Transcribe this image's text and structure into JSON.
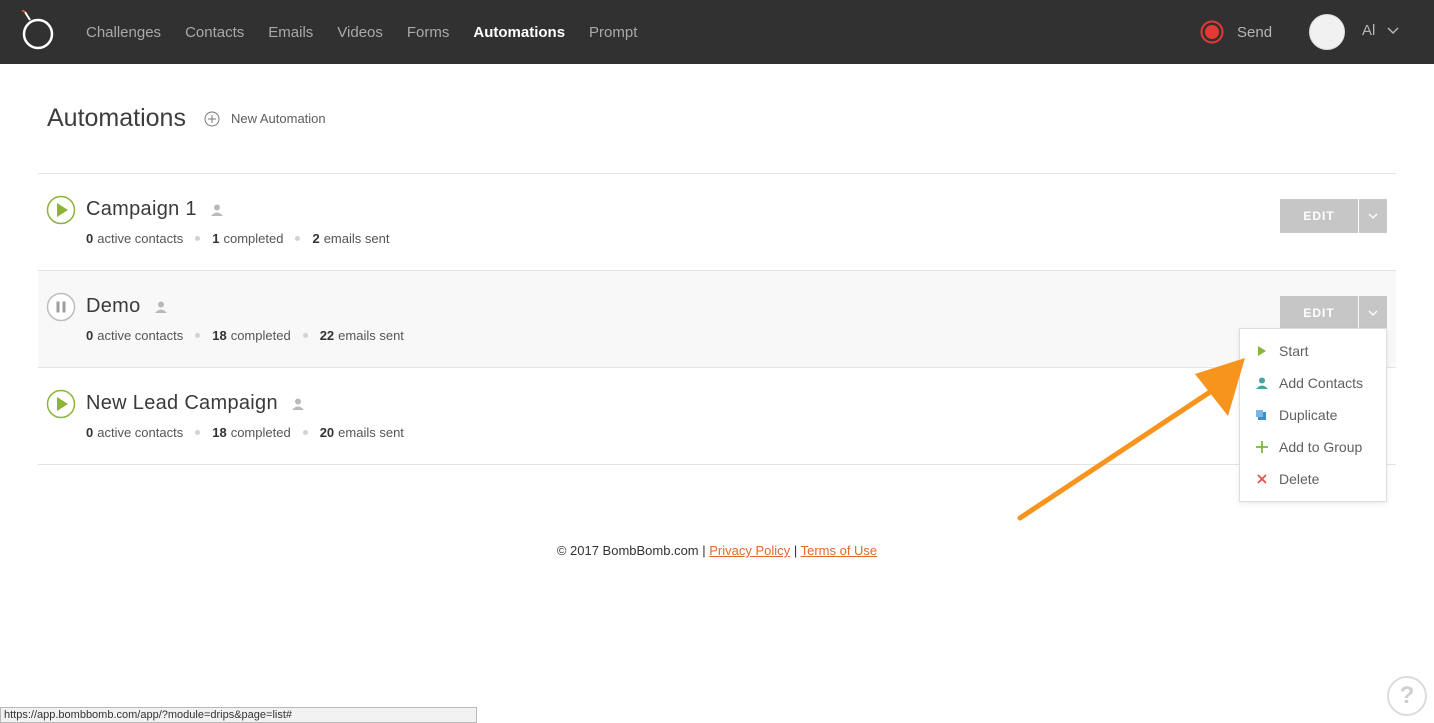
{
  "nav": {
    "items": [
      {
        "label": "Challenges",
        "active": false
      },
      {
        "label": "Contacts",
        "active": false
      },
      {
        "label": "Emails",
        "active": false
      },
      {
        "label": "Videos",
        "active": false
      },
      {
        "label": "Forms",
        "active": false
      },
      {
        "label": "Automations",
        "active": true
      },
      {
        "label": "Prompt",
        "active": false
      }
    ],
    "send_label": "Send",
    "user_name": "Al"
  },
  "page": {
    "title": "Automations",
    "new_label": "New Automation"
  },
  "automations": [
    {
      "name": "Campaign 1",
      "status": "paused-play",
      "active": "0",
      "active_label": "active contacts",
      "completed": "1",
      "completed_label": "completed",
      "emails": "2",
      "emails_label": "emails sent",
      "edit_label": "EDIT"
    },
    {
      "name": "Demo",
      "status": "paused",
      "active": "0",
      "active_label": "active contacts",
      "completed": "18",
      "completed_label": "completed",
      "emails": "22",
      "emails_label": "emails sent",
      "edit_label": "EDIT"
    },
    {
      "name": "New Lead Campaign",
      "status": "paused-play",
      "active": "0",
      "active_label": "active contacts",
      "completed": "18",
      "completed_label": "completed",
      "emails": "20",
      "emails_label": "emails sent",
      "edit_label": ""
    }
  ],
  "menu": {
    "items": [
      {
        "label": "Start",
        "icon": "play-icon",
        "color": "#8cb33a"
      },
      {
        "label": "Add Contacts",
        "icon": "person-icon",
        "color": "#4aa3a3"
      },
      {
        "label": "Duplicate",
        "icon": "duplicate-icon",
        "color": "#3d8fc6"
      },
      {
        "label": "Add to Group",
        "icon": "plus-icon",
        "color": "#7ab648"
      },
      {
        "label": "Delete",
        "icon": "x-icon",
        "color": "#d9534f"
      }
    ]
  },
  "footer": {
    "copyright": "© 2017 BombBomb.com |",
    "privacy": "Privacy Policy",
    "sep": "|",
    "terms": "Terms of Use"
  },
  "statusbar": {
    "url": "https://app.bombbomb.com/app/?module=drips&page=list#"
  },
  "help": {
    "label": "?"
  },
  "colors": {
    "topbar": "#313131",
    "accent_green": "#8cb33a",
    "annotation_arrow": "#f7941d",
    "link": "#e06a2c"
  }
}
